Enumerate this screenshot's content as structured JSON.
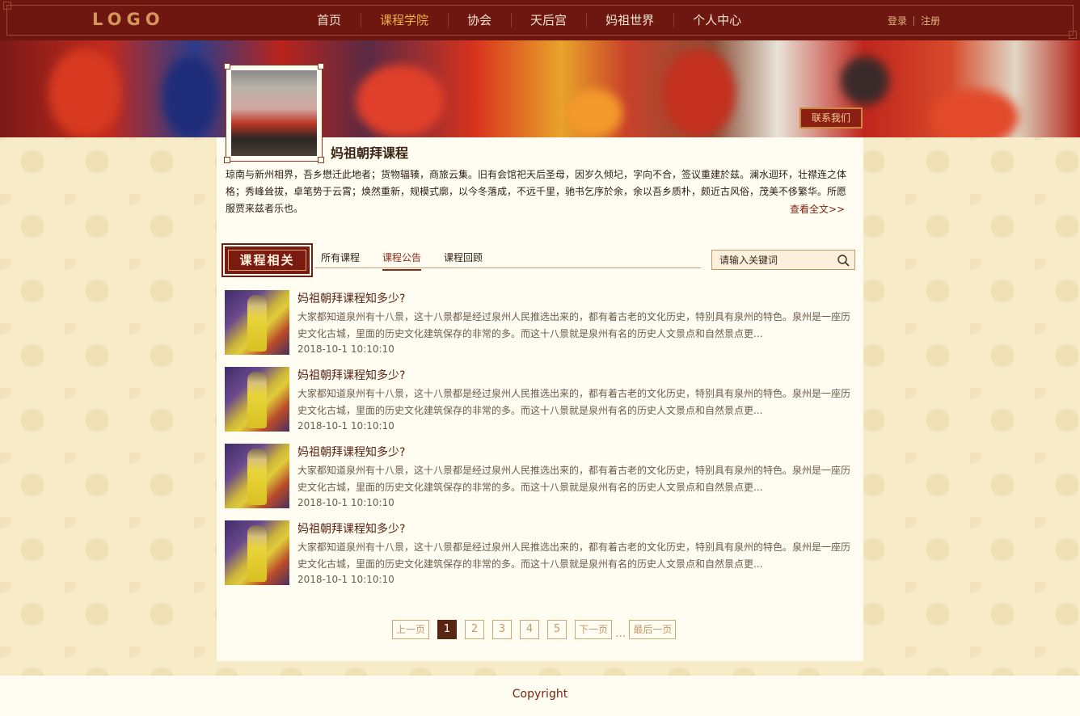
{
  "header": {
    "logo": "LOGO",
    "nav": [
      "首页",
      "课程学院",
      "协会",
      "天后宫",
      "妈祖世界",
      "个人中心"
    ],
    "active_nav": "课程学院",
    "login": "登录",
    "register": "注册"
  },
  "banner": {
    "contact_label": "联系我们"
  },
  "course": {
    "title": "妈祖朝拜课程",
    "description": "琼南与新州相界，吾乡懋迁此地者；货物辐辏，商旅云集。旧有会馆祀天后圣母，因岁久倾圮，字向不合，签议重建於兹。澜水迴环，壮襟连之体格；秀峰耸拔，卓笔势于云霄；焕然重新，规模式廓，以今冬落成，不远千里，驰书乞序於余，余以吾乡质朴，颇近古风俗，茂美不侈繁华。所愿服贾来兹者乐也。",
    "read_more": "查看全文>>"
  },
  "section": {
    "badge": "课程相关",
    "tabs": [
      "所有课程",
      "课程公告",
      "课程回顾"
    ],
    "active_tab": "课程公告",
    "search_placeholder": "请输入关键词"
  },
  "list": [
    {
      "title": "妈祖朝拜课程知多少?",
      "summary": "大家都知道泉州有十八景，这十八景都是经过泉州人民推选出来的，都有着古老的文化历史，特别具有泉州的特色。泉州是一座历史文化古城，里面的历史文化建筑保存的非常的多。而这十八景就是泉州有名的历史人文景点和自然景点更...",
      "date": "2018-10-1 10:10:10"
    },
    {
      "title": "妈祖朝拜课程知多少?",
      "summary": "大家都知道泉州有十八景，这十八景都是经过泉州人民推选出来的，都有着古老的文化历史，特别具有泉州的特色。泉州是一座历史文化古城，里面的历史文化建筑保存的非常的多。而这十八景就是泉州有名的历史人文景点和自然景点更...",
      "date": "2018-10-1 10:10:10"
    },
    {
      "title": "妈祖朝拜课程知多少?",
      "summary": "大家都知道泉州有十八景，这十八景都是经过泉州人民推选出来的，都有着古老的文化历史，特别具有泉州的特色。泉州是一座历史文化古城，里面的历史文化建筑保存的非常的多。而这十八景就是泉州有名的历史人文景点和自然景点更...",
      "date": "2018-10-1 10:10:10"
    },
    {
      "title": "妈祖朝拜课程知多少?",
      "summary": "大家都知道泉州有十八景，这十八景都是经过泉州人民推选出来的，都有着古老的文化历史，特别具有泉州的特色。泉州是一座历史文化古城，里面的历史文化建筑保存的非常的多。而这十八景就是泉州有名的历史人文景点和自然景点更...",
      "date": "2018-10-1 10:10:10"
    }
  ],
  "pagination": {
    "prev": "上一页",
    "pages": [
      "1",
      "2",
      "3",
      "4",
      "5"
    ],
    "current": "1",
    "next": "下一页",
    "ellipsis": "...",
    "last": "最后一页"
  },
  "footer": {
    "copyright": "Copyright"
  },
  "colors": {
    "header_bg": "#6e1710",
    "accent_gold": "#f0b040",
    "brand_red": "#7a1b12",
    "page_bg": "#f8ecc8",
    "panel_bg": "#fffdf1"
  },
  "icons": {
    "search": "search-icon"
  }
}
